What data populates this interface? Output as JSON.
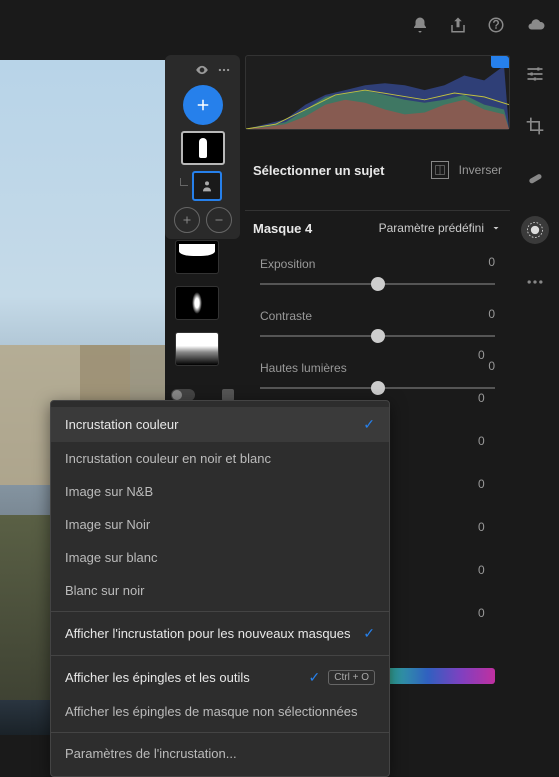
{
  "topbar": {
    "icons": [
      "bell",
      "share",
      "help",
      "cloud"
    ]
  },
  "subject": {
    "title": "Sélectionner un sujet",
    "invert": "Inverser"
  },
  "mask_header": {
    "name": "Masque 4",
    "preset": "Paramètre prédéfini"
  },
  "sliders": [
    {
      "label": "Exposition",
      "value": "0"
    },
    {
      "label": "Contraste",
      "value": "0"
    },
    {
      "label": "Hautes lumières",
      "value": "0"
    }
  ],
  "hidden_values": [
    "0",
    "0",
    "0",
    "0",
    "0",
    "0",
    "0",
    "0"
  ],
  "context_menu": {
    "items": [
      {
        "label": "Incrustation couleur",
        "checked": true,
        "selected": true
      },
      {
        "label": "Incrustation couleur en noir et blanc"
      },
      {
        "label": "Image sur N&B"
      },
      {
        "label": "Image sur Noir"
      },
      {
        "label": "Image sur blanc"
      },
      {
        "label": "Blanc sur noir"
      }
    ],
    "show_overlay_new": {
      "label": "Afficher l'incrustation pour les nouveaux masques",
      "checked": true
    },
    "show_pins": {
      "label": "Afficher les épingles et les outils",
      "checked": true,
      "kbd": "Ctrl + O"
    },
    "show_unselected": {
      "label": "Afficher les épingles de masque non sélectionnées"
    },
    "params": {
      "label": "Paramètres de l'incrustation..."
    }
  },
  "chart_data": {
    "type": "area",
    "title": "Histogram",
    "xlim": [
      0,
      255
    ],
    "ylim": [
      0,
      1
    ],
    "series": [
      {
        "name": "R",
        "color": "#d04040"
      },
      {
        "name": "G",
        "color": "#50b050"
      },
      {
        "name": "B",
        "color": "#4060d0"
      },
      {
        "name": "L",
        "color": "#c0c040"
      }
    ]
  }
}
